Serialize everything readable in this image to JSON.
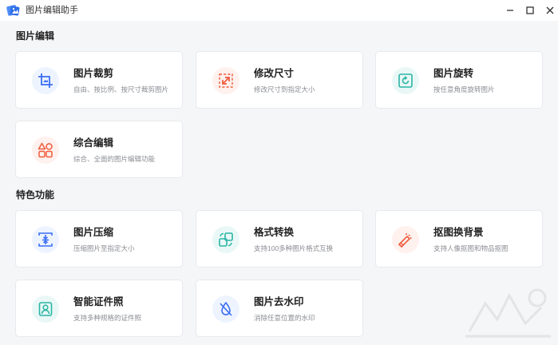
{
  "window": {
    "title": "图片编辑助手"
  },
  "sections": [
    {
      "title": "图片编辑",
      "cards": [
        {
          "title": "图片裁剪",
          "desc": "自由、按比例、按尺寸裁剪图片",
          "icon": "crop-icon"
        },
        {
          "title": "修改尺寸",
          "desc": "修改尺寸到指定大小",
          "icon": "resize-icon"
        },
        {
          "title": "图片旋转",
          "desc": "按任意角度旋转图片",
          "icon": "rotate-icon"
        },
        {
          "title": "综合编辑",
          "desc": "综合、全面的图片编辑功能",
          "icon": "shapes-icon"
        }
      ]
    },
    {
      "title": "特色功能",
      "cards": [
        {
          "title": "图片压缩",
          "desc": "压缩图片至指定大小",
          "icon": "compress-icon"
        },
        {
          "title": "格式转换",
          "desc": "支持100多种图片格式互换",
          "icon": "convert-icon"
        },
        {
          "title": "抠图换背景",
          "desc": "支持人像抠图和物品抠图",
          "icon": "cutout-icon"
        },
        {
          "title": "智能证件照",
          "desc": "支持多种规格的证件照",
          "icon": "id-photo-icon"
        },
        {
          "title": "图片去水印",
          "desc": "消除任意位置的水印",
          "icon": "watermark-remove-icon"
        }
      ]
    }
  ],
  "colors": {
    "blue": "#3b6ef5",
    "red": "#f05a3c",
    "teal": "#2bb5a5"
  }
}
